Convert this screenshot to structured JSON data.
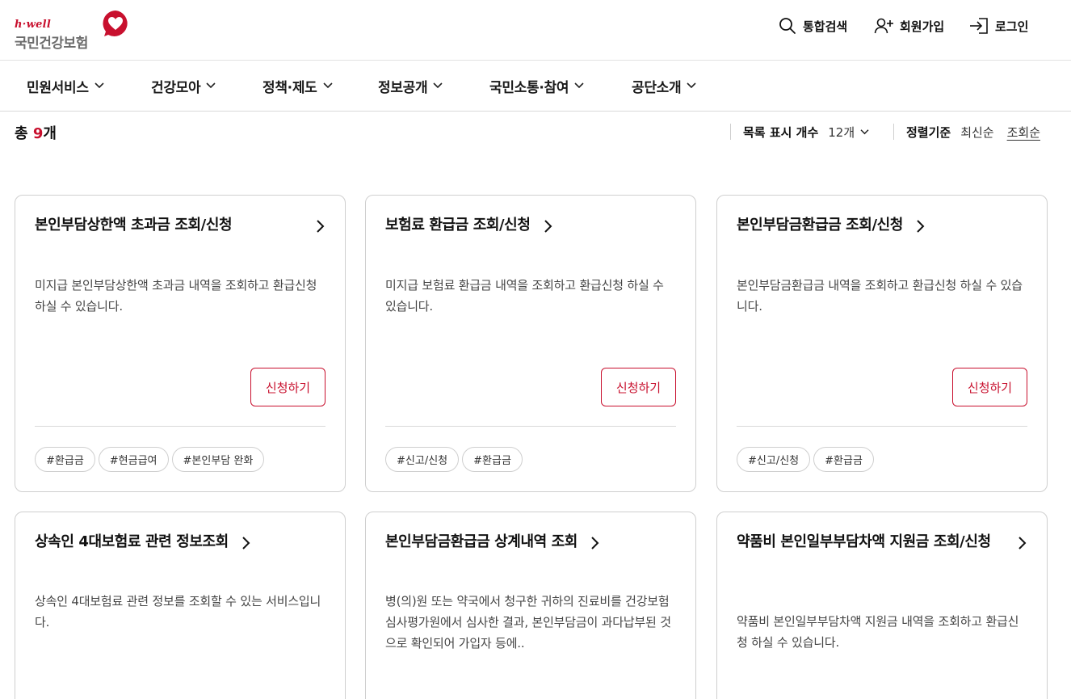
{
  "header": {
    "logo_tag": "h·well",
    "logo_name": "국민건강보험",
    "search_label": "통합검색",
    "join_label": "회원가입",
    "login_label": "로그인"
  },
  "gnb": {
    "items": [
      {
        "label": "민원서비스"
      },
      {
        "label": "건강모아"
      },
      {
        "label": "정책·제도"
      },
      {
        "label": "정보공개"
      },
      {
        "label": "국민소통·참여"
      },
      {
        "label": "공단소개"
      }
    ]
  },
  "listbar": {
    "total_prefix": "총",
    "total_count": "9",
    "total_suffix": "개",
    "page_size_label": "목록 표시 개수",
    "page_size_value": "12개",
    "sort_label": "정렬기준",
    "sort_options": [
      "최신순",
      "조회순"
    ],
    "sort_active": "조회순"
  },
  "colors": {
    "brand_red": "#c8102e",
    "text": "#111111",
    "border": "#cfcfcf"
  },
  "cards": [
    {
      "title": "본인부담상한액 초과금 조회/신청",
      "desc": "미지급 본인부담상한액 초과금 내역을 조회하고 환급신청 하실 수 있습니다.",
      "button": "신청하기",
      "tags": [
        "#환급금",
        "#현금급여",
        "#본인부담 완화"
      ]
    },
    {
      "title": "보험료 환급금 조회/신청",
      "desc": "미지급 보험료 환급금 내역을 조회하고 환급신청 하실 수 있습니다.",
      "button": "신청하기",
      "tags": [
        "#신고/신청",
        "#환급금"
      ]
    },
    {
      "title": "본인부담금환급금 조회/신청",
      "desc": "본인부담금환급금 내역을 조회하고 환급신청 하실 수 있습니다.",
      "button": "신청하기",
      "tags": [
        "#신고/신청",
        "#환급금"
      ]
    },
    {
      "title": "상속인 4대보험료 관련 정보조회",
      "desc": "상속인 4대보험료 관련 정보를 조회할 수 있는 서비스입니다."
    },
    {
      "title": "본인부담금환급금 상계내역 조회",
      "desc": "병(의)원 또는 약국에서 청구한 귀하의 진료비를 건강보험심사평가원에서 심사한 결과, 본인부담금이 과다납부된 것으로 확인되어 가입자 등에.."
    },
    {
      "title": "약품비 본인일부부담차액 지원금 조회/신청",
      "desc": "약품비 본인일부부담차액 지원금 내역을 조회하고 환급신청 하실 수 있습니다."
    }
  ]
}
